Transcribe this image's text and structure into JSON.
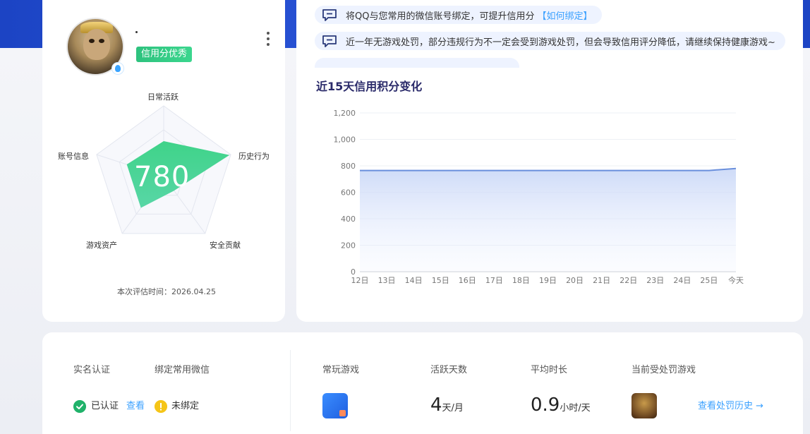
{
  "profile": {
    "username": "·",
    "credit_badge": "信用分优秀",
    "score": "780",
    "eval_time": "本次评估时间：2026.04.25"
  },
  "radar": {
    "labels": {
      "daily": "日常活跃",
      "history": "历史行为",
      "security": "安全贡献",
      "assets": "游戏资产",
      "account": "账号信息"
    },
    "values": {
      "daily": 0.5,
      "history": 0.98,
      "security": 0.25,
      "assets": 0.55,
      "account": 0.55
    }
  },
  "notices": [
    {
      "text": "将QQ与您常用的微信账号绑定，可提升信用分",
      "link": "【如何绑定】"
    },
    {
      "text": "近一年无游戏处罚，部分违规行为不一定会受到游戏处罚，但会导致信用评分降低，请继续保持健康游戏~",
      "link": ""
    }
  ],
  "chart_data": {
    "type": "area",
    "title": "近15天信用积分变化",
    "categories": [
      "12日",
      "13日",
      "14日",
      "15日",
      "16日",
      "17日",
      "18日",
      "19日",
      "20日",
      "21日",
      "22日",
      "23日",
      "24日",
      "25日",
      "今天"
    ],
    "values": [
      765,
      765,
      765,
      765,
      765,
      765,
      765,
      765,
      765,
      765,
      765,
      765,
      765,
      765,
      780
    ],
    "ylim": [
      0,
      1200
    ],
    "yticks": [
      "0",
      "200",
      "400",
      "600",
      "800",
      "1,000",
      "1,200"
    ],
    "grid": true
  },
  "bottom": {
    "real_name_label": "实名认证",
    "wechat_label": "绑定常用微信",
    "verified_text": "已认证",
    "view_link": "查看",
    "unbound_text": "未绑定",
    "frequent_games_label": "常玩游戏",
    "active_days_label": "活跃天数",
    "active_days_value": "4",
    "active_days_unit": "天/月",
    "avg_duration_label": "平均时长",
    "avg_duration_value": "0.9",
    "avg_duration_unit": "小时/天",
    "penalty_game_label": "当前受处罚游戏",
    "history_link": "查看处罚历史 →"
  },
  "colors": {
    "accent": "#3aa0ff",
    "green": "#2ec27e",
    "line": "#6a8fdc"
  }
}
